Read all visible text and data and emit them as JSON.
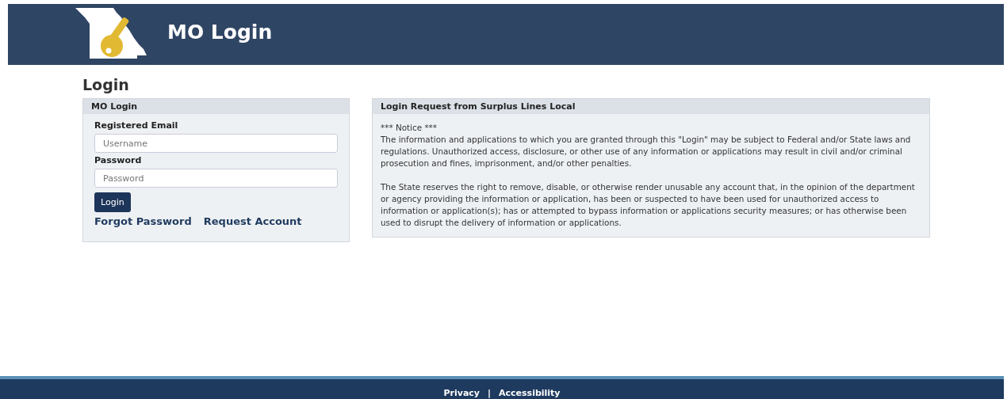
{
  "header": {
    "title": "MO Login"
  },
  "page_title": "Login",
  "login_panel": {
    "title": "MO Login",
    "email_label": "Registered Email",
    "email_placeholder": "Username",
    "password_label": "Password",
    "password_placeholder": "Password",
    "button": "Login",
    "links": [
      "Forgot Password",
      "Request Account"
    ]
  },
  "notice_panel": {
    "title": "Login Request from Surplus Lines Local",
    "heading": "*** Notice ***",
    "paragraphs": [
      "The information and applications to which you are granted through this \"Login\" may be subject to Federal and/or State laws and regulations. Unauthorized access, disclosure, or other use of any information or applications may result in civil and/or criminal prosecution and fines, imprisonment, and/or other penalties.",
      "The State reserves the right to remove, disable, or otherwise render unusable any account that, in the opinion of the department or agency providing the information or application, has been or suspected to have been used for unauthorized access to information or application(s); has or attempted to bypass information or applications security measures; or has otherwise been used to disrupt the delivery of information or applications."
    ]
  },
  "footer": {
    "links": [
      "Privacy",
      "Accessibility"
    ],
    "separator": "|"
  }
}
